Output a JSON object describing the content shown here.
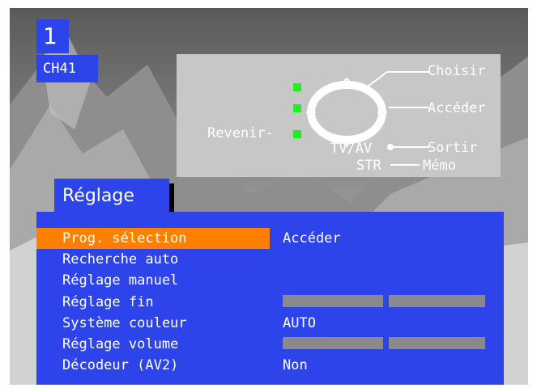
{
  "channel": {
    "number": "1",
    "name": "CH41"
  },
  "help": {
    "choose": "Choisir",
    "access": "Accéder",
    "back": "Revenir-",
    "tvav": "TV/AV",
    "exit": "Sortir",
    "str": "STR",
    "memo": "Mémo"
  },
  "menu": {
    "title": "Réglage",
    "items": [
      {
        "label": "Prog. sélection",
        "value": "Accéder",
        "selected": true
      },
      {
        "label": "Recherche auto",
        "value": ""
      },
      {
        "label": "Réglage manuel",
        "value": ""
      },
      {
        "label": "Réglage fin",
        "value": "",
        "slider": true
      },
      {
        "label": "Système couleur",
        "value": "AUTO"
      },
      {
        "label": "Réglage volume",
        "value": "",
        "slider": true
      },
      {
        "label": "Décodeur (AV2)",
        "value": "Non"
      }
    ]
  },
  "colors": {
    "menu_bg": "#2d44ea",
    "highlight": "#ff8000",
    "help_bg": "#c7c7c7",
    "indicator": "#22ee22",
    "slider": "#8a8a8a"
  }
}
